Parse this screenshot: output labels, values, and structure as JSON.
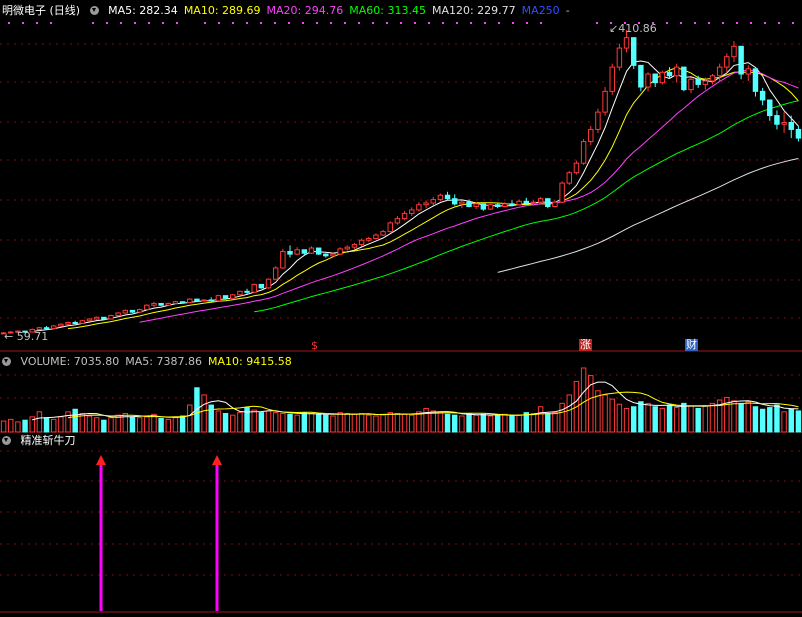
{
  "stock": {
    "name": "明微电子",
    "period": "(日线)"
  },
  "ma_legend": [
    {
      "label": "MA5: 282.34",
      "color": "#ffffff"
    },
    {
      "label": "MA10: 289.69",
      "color": "#ffff00"
    },
    {
      "label": "MA20: 294.76",
      "color": "#ff40ff"
    },
    {
      "label": "MA60: 313.45",
      "color": "#00ff00"
    },
    {
      "label": "MA120: 229.77",
      "color": "#e0e0e0"
    },
    {
      "label": "MA250",
      "color": "#3050ff"
    },
    {
      "label": "-",
      "color": "#c0c0c0"
    }
  ],
  "price_labels": {
    "high": "410.86",
    "low": "59.71"
  },
  "markers": [
    {
      "text": "$",
      "color": "#ff3030",
      "bg": ""
    },
    {
      "text": "涨",
      "color": "#ffffff",
      "bg": "#c02020"
    },
    {
      "text": "财",
      "color": "#ffffff",
      "bg": "#3060c0"
    }
  ],
  "volume_legend": [
    {
      "label": "VOLUME: 7035.80",
      "color": "#c0c0c0"
    },
    {
      "label": "MA5: 7387.86",
      "color": "#c0c0c0"
    },
    {
      "label": "MA10: 9415.58",
      "color": "#ffff00"
    }
  ],
  "indicator": {
    "title": "精准斩牛刀",
    "signals": [
      1,
      2
    ]
  },
  "chart_data": {
    "type": "candlestick",
    "price_axis": {
      "min": 59.71,
      "max": 410.86
    },
    "ohlc": [
      [
        60,
        62,
        59.7,
        61
      ],
      [
        61,
        63,
        60,
        62
      ],
      [
        62,
        64,
        61,
        63
      ],
      [
        63,
        62,
        61,
        62
      ],
      [
        62,
        66,
        62,
        65
      ],
      [
        65,
        68,
        64,
        67
      ],
      [
        67,
        69,
        65,
        66
      ],
      [
        66,
        70,
        66,
        69
      ],
      [
        69,
        72,
        68,
        71
      ],
      [
        71,
        74,
        70,
        73
      ],
      [
        73,
        75,
        71,
        72
      ],
      [
        72,
        76,
        72,
        75
      ],
      [
        75,
        78,
        74,
        77
      ],
      [
        77,
        80,
        76,
        79
      ],
      [
        79,
        78,
        76,
        77
      ],
      [
        77,
        82,
        77,
        81
      ],
      [
        81,
        85,
        80,
        84
      ],
      [
        84,
        88,
        83,
        87
      ],
      [
        87,
        86,
        84,
        85
      ],
      [
        85,
        89,
        85,
        88
      ],
      [
        88,
        94,
        87,
        93
      ],
      [
        93,
        97,
        91,
        95
      ],
      [
        95,
        94,
        92,
        93
      ],
      [
        93,
        96,
        93,
        95
      ],
      [
        95,
        98,
        94,
        97
      ],
      [
        97,
        96,
        95,
        96
      ],
      [
        96,
        101,
        96,
        100
      ],
      [
        100,
        99,
        97,
        98
      ],
      [
        98,
        100,
        97,
        99
      ],
      [
        99,
        102,
        97,
        98
      ],
      [
        98,
        105,
        98,
        104
      ],
      [
        104,
        103,
        100,
        101
      ],
      [
        101,
        106,
        101,
        105
      ],
      [
        105,
        110,
        104,
        109
      ],
      [
        109,
        112,
        106,
        108
      ],
      [
        108,
        118,
        108,
        117
      ],
      [
        117,
        116,
        112,
        113
      ],
      [
        113,
        124,
        112,
        123
      ],
      [
        123,
        138,
        122,
        136
      ],
      [
        136,
        158,
        135,
        155
      ],
      [
        155,
        162,
        148,
        152
      ],
      [
        152,
        160,
        151,
        157
      ],
      [
        157,
        156,
        150,
        153
      ],
      [
        153,
        161,
        152,
        159
      ],
      [
        159,
        156,
        151,
        152
      ],
      [
        152,
        153,
        148,
        150
      ],
      [
        150,
        154,
        149,
        152
      ],
      [
        152,
        160,
        151,
        158
      ],
      [
        158,
        162,
        156,
        160
      ],
      [
        160,
        165,
        158,
        163
      ],
      [
        163,
        170,
        161,
        168
      ],
      [
        168,
        172,
        166,
        170
      ],
      [
        170,
        176,
        169,
        174
      ],
      [
        174,
        180,
        173,
        178
      ],
      [
        178,
        190,
        177,
        188
      ],
      [
        188,
        196,
        186,
        193
      ],
      [
        193,
        202,
        191,
        199
      ],
      [
        199,
        206,
        196,
        203
      ],
      [
        203,
        212,
        201,
        209
      ],
      [
        209,
        214,
        205,
        211
      ],
      [
        211,
        218,
        208,
        215
      ],
      [
        215,
        222,
        213,
        220
      ],
      [
        220,
        224,
        214,
        216
      ],
      [
        216,
        221,
        208,
        210
      ],
      [
        210,
        214,
        205,
        212
      ],
      [
        212,
        215,
        206,
        207
      ],
      [
        207,
        212,
        204,
        210
      ],
      [
        210,
        208,
        202,
        204
      ],
      [
        204,
        210,
        203,
        209
      ],
      [
        209,
        211,
        205,
        207
      ],
      [
        207,
        212,
        206,
        210
      ],
      [
        210,
        214,
        207,
        209
      ],
      [
        209,
        215,
        208,
        213
      ],
      [
        213,
        217,
        209,
        211
      ],
      [
        211,
        214,
        208,
        212
      ],
      [
        212,
        218,
        210,
        216
      ],
      [
        216,
        212,
        205,
        207
      ],
      [
        207,
        214,
        206,
        212
      ],
      [
        212,
        236,
        211,
        234
      ],
      [
        234,
        248,
        232,
        246
      ],
      [
        246,
        260,
        244,
        257
      ],
      [
        257,
        285,
        255,
        282
      ],
      [
        282,
        300,
        278,
        296
      ],
      [
        296,
        320,
        292,
        316
      ],
      [
        316,
        345,
        312,
        340
      ],
      [
        340,
        372,
        336,
        368
      ],
      [
        368,
        395,
        364,
        390
      ],
      [
        390,
        410.86,
        385,
        402
      ],
      [
        402,
        390,
        366,
        370
      ],
      [
        370,
        368,
        340,
        345
      ],
      [
        345,
        362,
        340,
        360
      ],
      [
        360,
        356,
        345,
        350
      ],
      [
        350,
        364,
        348,
        362
      ],
      [
        362,
        368,
        355,
        358
      ],
      [
        358,
        372,
        350,
        368
      ],
      [
        368,
        365,
        340,
        342
      ],
      [
        342,
        356,
        338,
        354
      ],
      [
        354,
        358,
        344,
        348
      ],
      [
        348,
        356,
        342,
        352
      ],
      [
        352,
        360,
        348,
        358
      ],
      [
        358,
        372,
        352,
        368
      ],
      [
        368,
        384,
        362,
        380
      ],
      [
        380,
        398,
        374,
        392
      ],
      [
        392,
        376,
        354,
        360
      ],
      [
        360,
        370,
        352,
        366
      ],
      [
        366,
        356,
        334,
        340
      ],
      [
        340,
        344,
        324,
        330
      ],
      [
        330,
        326,
        306,
        312
      ],
      [
        312,
        318,
        296,
        302
      ],
      [
        302,
        316,
        292,
        304
      ],
      [
        304,
        312,
        286,
        296
      ],
      [
        296,
        300,
        282,
        286
      ]
    ],
    "volume": [
      2600,
      3000,
      2400,
      2800,
      3600,
      4800,
      3400,
      3000,
      3600,
      4800,
      5400,
      4400,
      3800,
      3400,
      2800,
      3400,
      4000,
      4400,
      3600,
      3400,
      3600,
      4200,
      3200,
      3000,
      3400,
      3800,
      6400,
      10500,
      8800,
      6400,
      5000,
      4400,
      4000,
      4600,
      5800,
      5200,
      4600,
      5000,
      4600,
      4400,
      4200,
      4000,
      4600,
      4400,
      4200,
      4000,
      3800,
      4600,
      4400,
      4200,
      4400,
      4000,
      3800,
      4200,
      4600,
      4400,
      4200,
      4000,
      4800,
      5600,
      5000,
      4600,
      4200,
      4000,
      3800,
      4400,
      4000,
      4200,
      3800,
      4000,
      4200,
      3800,
      4000,
      4600,
      4400,
      6000,
      4400,
      4600,
      6800,
      8800,
      12000,
      15200,
      13400,
      9800,
      8800,
      7800,
      6600,
      5600,
      6000,
      7200,
      6800,
      6000,
      5600,
      6400,
      5800,
      6800,
      6200,
      5600,
      6200,
      6800,
      7600,
      8200,
      7400,
      6800,
      7200,
      6000,
      5400,
      5800,
      6400,
      4800,
      5400,
      5000
    ],
    "ma_overlays": [
      {
        "name": "MA5",
        "color": "#ffffff"
      },
      {
        "name": "MA10",
        "color": "#ffff00"
      },
      {
        "name": "MA20",
        "color": "#ff40ff"
      },
      {
        "name": "MA60",
        "color": "#00ff00"
      },
      {
        "name": "MA120",
        "color": "#e0e0e0"
      }
    ],
    "volume_overlays": [
      {
        "name": "MA5",
        "color": "#ffffff"
      },
      {
        "name": "MA10",
        "color": "#ffff00"
      }
    ]
  }
}
